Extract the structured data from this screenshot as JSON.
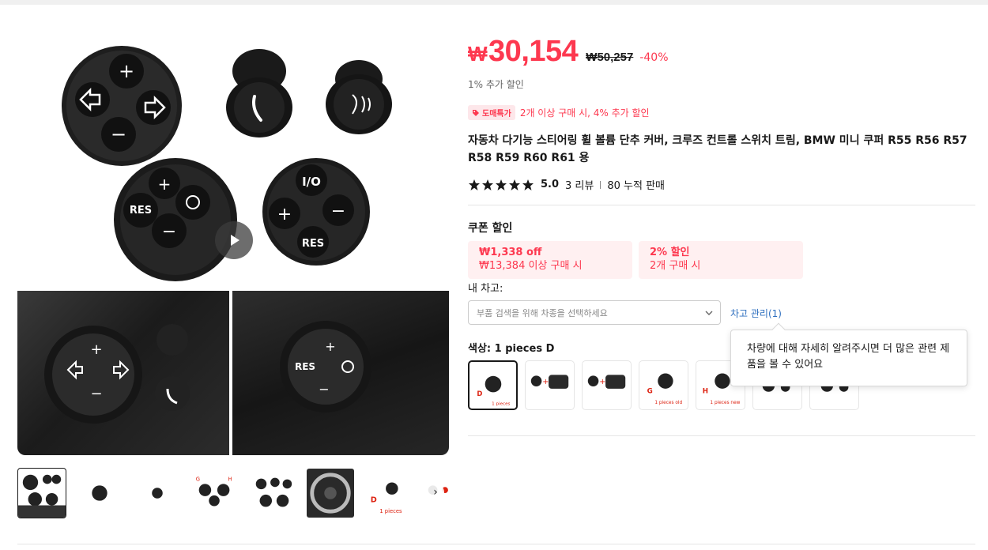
{
  "product": {
    "price_currency": "₩",
    "price": "30,154",
    "original_price": "₩50,257",
    "discount": "-40%",
    "extra_discount": "1% 추가 할인",
    "bulk_badge": "도매특가",
    "bulk_text": "2개 이상 구매 시, 4% 추가 할인",
    "title": "자동차 다기능 스티어링 휠 볼륨 단추 커버, 크루즈 컨트롤 스위치 트림, BMW 미니 쿠퍼 R55 R56 R57 R58 R59 R60 R61 용",
    "rating": "5.0",
    "reviews": "3 리뷰",
    "sold": "80 누적 판매",
    "stars": 5
  },
  "coupons": {
    "title": "쿠폰 할인",
    "items": [
      {
        "line1": "₩1,338 off",
        "line2": "₩13,384 이상 구매 시"
      },
      {
        "line1": "2% 할인",
        "line2": "2개 구매 시"
      }
    ]
  },
  "car": {
    "label": "내 차고:",
    "placeholder": "부품 검색을 위해 차종을 선택하세요",
    "garage_link": "차고 관리(1)",
    "tooltip": "차량에 대해 자세히 알려주시면 더 많은 관련 제품을 볼 수 있어요"
  },
  "color": {
    "label": "색상: 1 pieces D",
    "swatch_captions": [
      "D",
      "1 pieces",
      "G",
      "1 pieces old",
      "H",
      "1 pieces new"
    ]
  },
  "thumbs": {
    "captions": [
      "D",
      "1 pieces"
    ]
  },
  "colors": {
    "accent": "#fd384f",
    "link": "#2e6fbf"
  }
}
